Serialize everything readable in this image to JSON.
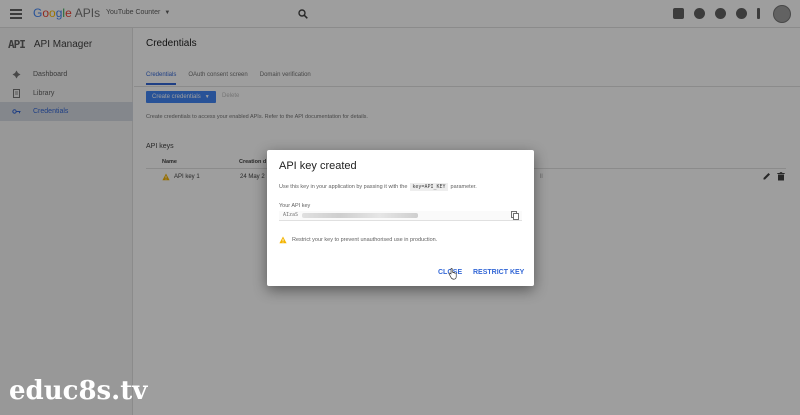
{
  "topbar": {
    "logo_letters": [
      "G",
      "o",
      "o",
      "g",
      "l",
      "e"
    ],
    "logo_suffix": "APIs",
    "project": "YouTube Counter",
    "icons": [
      "gift-icon",
      "chat-icon",
      "help-icon",
      "notifications-icon",
      "more-vert-icon"
    ]
  },
  "sidebar": {
    "mark": "API",
    "title": "API Manager",
    "items": [
      {
        "label": "Dashboard",
        "icon": "dashboard-icon"
      },
      {
        "label": "Library",
        "icon": "library-icon"
      },
      {
        "label": "Credentials",
        "icon": "key-icon",
        "active": true
      }
    ]
  },
  "main": {
    "title": "Credentials",
    "tabs": [
      "Credentials",
      "OAuth consent screen",
      "Domain verification"
    ],
    "create_button": "Create credentials",
    "delete_button": "Delete",
    "description": "Create credentials to access your enabled APIs. Refer to the API documentation for details.",
    "section_title": "API keys",
    "table": {
      "headers": [
        "Name",
        "Creation d"
      ],
      "rows": [
        {
          "name": "API key 1",
          "date": "24 May 2",
          "tail": "ll"
        }
      ]
    }
  },
  "dialog": {
    "title": "API key created",
    "desc_before": "Use this key in your application by passing it with the",
    "desc_code": "key=API_KEY",
    "desc_after": "parameter.",
    "key_label": "Your API key",
    "key_prefix": "AIzaS",
    "warning": "Restrict your key to prevent unauthorised use in production.",
    "close_button": "CLOSE",
    "restrict_button": "RESTRICT KEY"
  },
  "watermark": "educ8s.tv",
  "colors": {
    "accent": "#4285f4",
    "link": "#3367d6",
    "warning": "#f4b400"
  }
}
